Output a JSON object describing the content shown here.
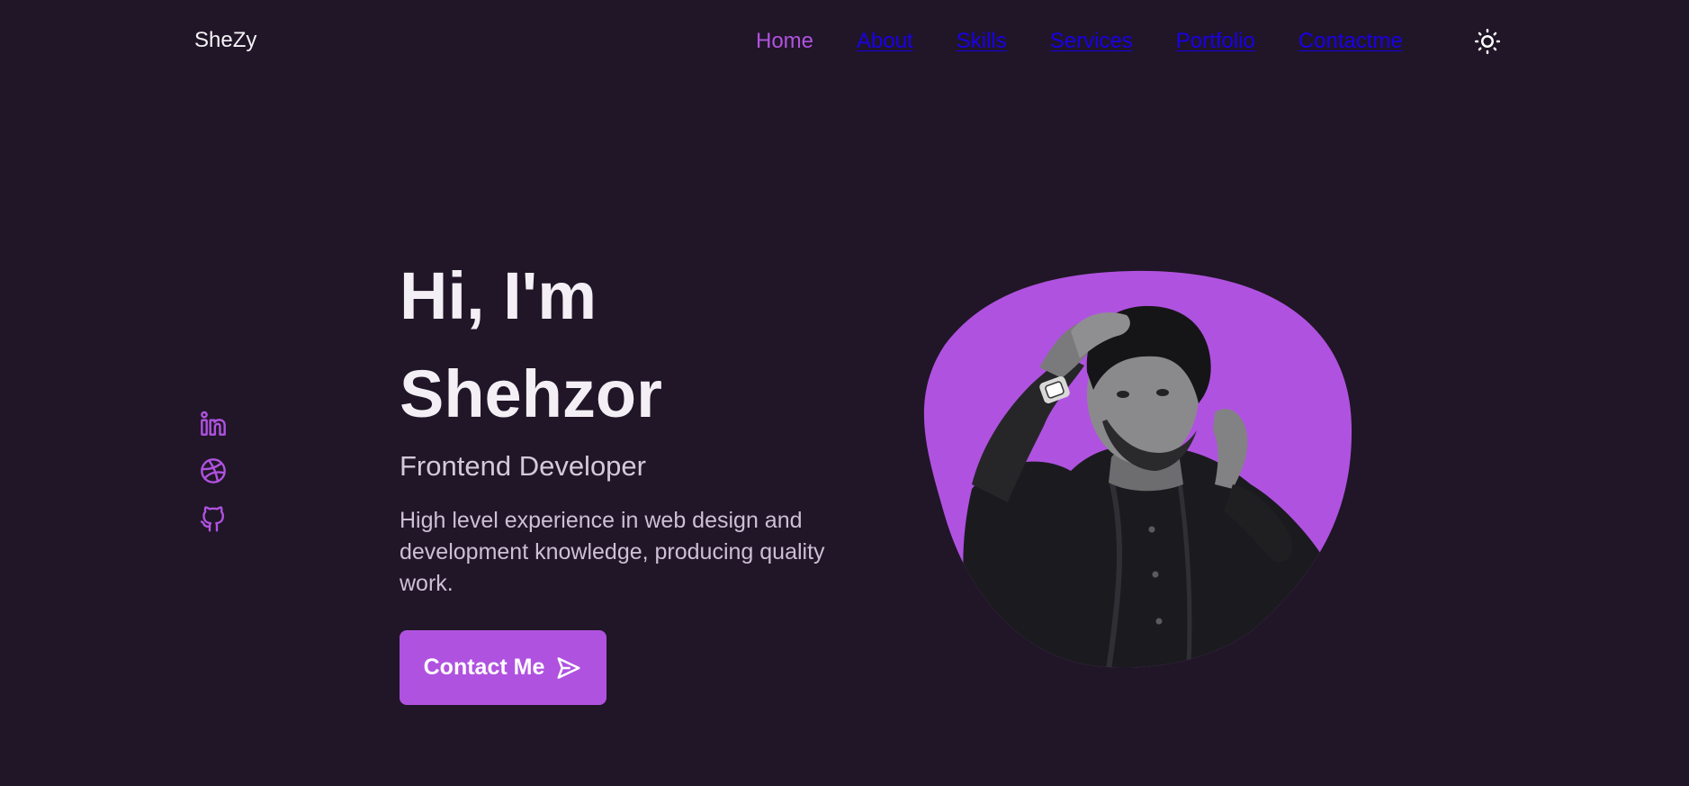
{
  "header": {
    "logo": "SheZy",
    "nav": [
      {
        "label": "Home",
        "active": true
      },
      {
        "label": "About",
        "active": false
      },
      {
        "label": "Skills",
        "active": false
      },
      {
        "label": "Services",
        "active": false
      },
      {
        "label": "Portfolio",
        "active": false
      },
      {
        "label": "Contactme",
        "active": false
      }
    ],
    "theme_toggle_icon": "sun-icon"
  },
  "socials": [
    {
      "icon": "linkedin-icon"
    },
    {
      "icon": "dribbble-icon"
    },
    {
      "icon": "github-icon"
    }
  ],
  "hero": {
    "title_line1": "Hi, I'm",
    "title_line2": "Shehzor",
    "subtitle": "Frontend Developer",
    "description": "High level experience in web design and development knowledge, producing quality work.",
    "cta_label": "Contact Me",
    "cta_icon": "send-icon",
    "image": "profile-photo"
  },
  "colors": {
    "background": "#201627",
    "accent": "#b052e0",
    "nav_link": "#1a00e6",
    "title": "#f3eff5",
    "text": "#cdbfd5"
  }
}
